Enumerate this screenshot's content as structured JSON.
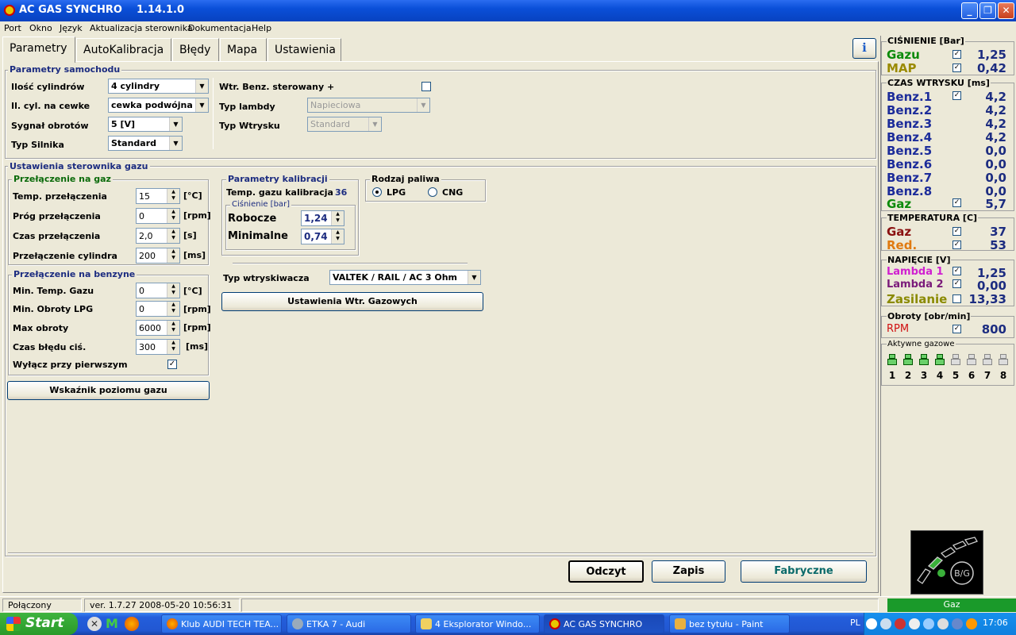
{
  "window": {
    "title": "AC GAS SYNCHRO    1.14.1.0"
  },
  "menu": [
    "Port",
    "Okno",
    "Język",
    "Aktualizacja sterownika",
    "Dokumentacja",
    "Help"
  ],
  "tabs": [
    "Parametry",
    "AutoKalibracja",
    "Błędy",
    "Mapa",
    "Ustawienia"
  ],
  "car": {
    "title": "Parametry samochodu",
    "cyl_label": "Ilość cylindrów",
    "cyl_value": "4 cylindry",
    "coil_label": "Il. cyl. na cewke",
    "coil_value": "cewka podwójna",
    "rpm_signal_label": "Sygnał obrotów",
    "rpm_signal_value": "5 [V]",
    "engine_label": "Typ Silnika",
    "engine_value": "Standard",
    "wtr_label": "Wtr. Benz. sterowany +",
    "lambda_label": "Typ lambdy",
    "lambda_value": "Napieciowa",
    "inj_type_label": "Typ Wtrysku",
    "inj_type_value": "Standard"
  },
  "gas": {
    "title": "Ustawienia sterownika gazu",
    "to_gas": {
      "title": "Przełączenie na gaz",
      "rows": [
        {
          "label": "Temp. przełączenia",
          "value": "15",
          "unit": "[°C]"
        },
        {
          "label": "Próg przełączenia",
          "value": "0",
          "unit": "[rpm]"
        },
        {
          "label": "Czas przełączenia",
          "value": "2,0",
          "unit": "[s]"
        },
        {
          "label": "Przełączenie cylindra",
          "value": "200",
          "unit": "[ms]"
        }
      ]
    },
    "to_petrol": {
      "title": "Przełączenie na benzyne",
      "rows": [
        {
          "label": "Min. Temp. Gazu",
          "value": "0",
          "unit": "[°C]"
        },
        {
          "label": "Min. Obroty LPG",
          "value": "0",
          "unit": "[rpm]"
        },
        {
          "label": "Max obroty",
          "value": "6000",
          "unit": "[rpm]"
        },
        {
          "label": "Czas błędu ciś.",
          "value": "300",
          "unit": "[ms]"
        }
      ],
      "first_off_label": "Wyłącz przy pierwszym",
      "check": "✓"
    },
    "level_button": "Wskaźnik poziomu gazu",
    "calib": {
      "title": "Parametry kalibracji",
      "temp_label": "Temp. gazu kalibracja",
      "temp_value": "36",
      "pressure_title": "Ciśnienie [bar]",
      "work_label": "Robocze",
      "work_value": "1,24",
      "min_label": "Minimalne",
      "min_value": "0,74"
    },
    "fuel": {
      "title": "Rodzaj paliwa",
      "lpg": "LPG",
      "cng": "CNG"
    },
    "injector_label": "Typ wtryskiwacza",
    "injector_value": "VALTEK / RAIL / AC 3 Ohm",
    "injector_settings_button": "Ustawienia Wtr. Gazowych"
  },
  "buttons": {
    "read": "Odczyt",
    "save": "Zapis",
    "factory": "Fabryczne"
  },
  "right": {
    "pressure": {
      "title": "CIŚNIENIE [Bar]",
      "rows": [
        {
          "name": "Gazu",
          "value": "1,25",
          "color": "#0a8a0a"
        },
        {
          "name": "MAP",
          "value": "0,42",
          "color": "#9a8a00"
        }
      ]
    },
    "injection": {
      "title": "CZAS WTRYSKU  [ms]",
      "rows": [
        {
          "name": "Benz.1",
          "value": "4,2"
        },
        {
          "name": "Benz.2",
          "value": "4,2"
        },
        {
          "name": "Benz.3",
          "value": "4,2"
        },
        {
          "name": "Benz.4",
          "value": "4,2"
        },
        {
          "name": "Benz.5",
          "value": "0,0"
        },
        {
          "name": "Benz.6",
          "value": "0,0"
        },
        {
          "name": "Benz.7",
          "value": "0,0"
        },
        {
          "name": "Benz.8",
          "value": "0,0"
        },
        {
          "name": "Gaz",
          "value": "5,7"
        }
      ]
    },
    "temperature": {
      "title": "TEMPERATURA  [C]",
      "rows": [
        {
          "name": "Gaz",
          "value": "37",
          "color": "#8a1010"
        },
        {
          "name": "Red.",
          "value": "53",
          "color": "#e07a10"
        }
      ]
    },
    "voltage": {
      "title": "NAPIĘCIE [V]",
      "rows": [
        {
          "name": "Lambda 1",
          "value": "1,25",
          "color": "#d020d0"
        },
        {
          "name": "Lambda 2",
          "value": "0,00",
          "color": "#7a1a7a"
        },
        {
          "name": "Zasilanie",
          "value": "13,33",
          "color": "#8a8a00"
        }
      ]
    },
    "rpm": {
      "title": "Obroty [obr/min]",
      "name": "RPM",
      "value": "800",
      "color": "#d01010"
    },
    "active": {
      "title": "Aktywne gazowe",
      "nums": [
        "1",
        "2",
        "3",
        "4",
        "5",
        "6",
        "7",
        "8"
      ]
    },
    "gauge_label": "B/G",
    "mode": "Gaz",
    "check": "✓"
  },
  "status": {
    "conn": "Połączony",
    "version": "ver. 1.7.27  2008-05-20 10:56:31"
  },
  "taskbar": {
    "start": "Start",
    "items": [
      "Klub AUDI TECH TEA...",
      "ETKA 7 - Audi",
      "4 Eksplorator Windo...",
      "AC GAS SYNCHRO",
      "bez tytułu - Paint"
    ],
    "lang": "PL",
    "clock": "17:06"
  }
}
